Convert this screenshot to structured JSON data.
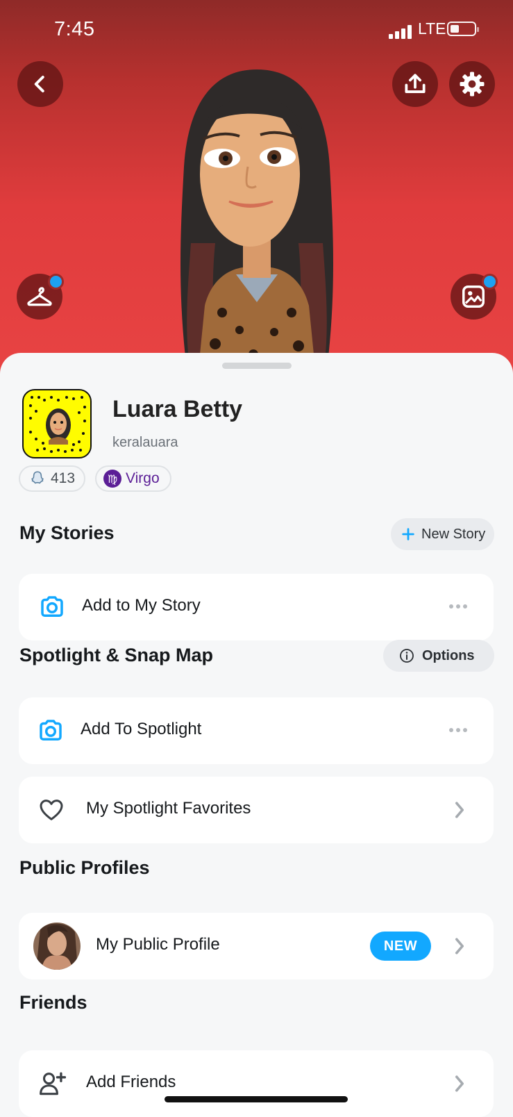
{
  "status_bar": {
    "time": "7:45",
    "network": "LTE"
  },
  "profile": {
    "display_name": "Luara Betty",
    "username": "keralauara",
    "snapscore": "413",
    "zodiac": "Virgo"
  },
  "my_stories": {
    "title": "My Stories",
    "new_story_label": "New Story",
    "add_label": "Add to My Story"
  },
  "spotlight": {
    "title": "Spotlight & Snap Map",
    "options_label": "Options",
    "add_label": "Add To Spotlight",
    "favorites_label": "My Spotlight Favorites"
  },
  "public_profiles": {
    "title": "Public Profiles",
    "my_profile_label": "My Public Profile",
    "badge": "NEW"
  },
  "friends": {
    "title": "Friends",
    "add_label": "Add Friends"
  },
  "colors": {
    "accent_blue": "#12a8ff",
    "snap_yellow": "#fffc00",
    "hero_red": "#e03c3d",
    "zodiac_purple": "#5b1e96"
  }
}
